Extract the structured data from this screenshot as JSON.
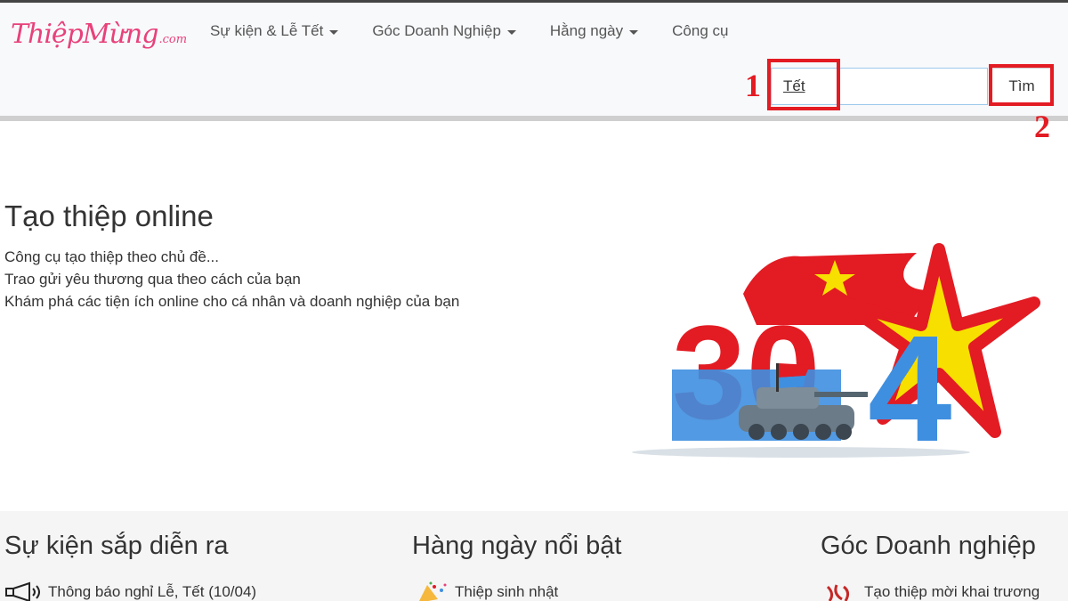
{
  "brand": {
    "logo_text": "ThiệpMừng",
    "logo_suffix": ".com"
  },
  "nav": {
    "items": [
      {
        "label": "Sự kiện & Lễ Tết",
        "dropdown": true
      },
      {
        "label": "Góc Doanh Nghiệp",
        "dropdown": true
      },
      {
        "label": "Hằng ngày",
        "dropdown": true
      },
      {
        "label": "Công cụ",
        "dropdown": false
      }
    ]
  },
  "search": {
    "value": "Tết",
    "button_label": "Tìm"
  },
  "annotations": {
    "step1": "1",
    "step2": "2",
    "color": "#e31b23"
  },
  "hero": {
    "title": "Tạo thiệp online",
    "lines": [
      "Công cụ tạo thiệp theo chủ đề...",
      "Trao gửi yêu thương qua theo cách của bạn",
      "Khám phá các tiện ích online cho cá nhân và doanh nghiệp của bạn"
    ]
  },
  "banner": {
    "text_left": "30",
    "text_right": "4"
  },
  "sections": [
    {
      "title": "Sự kiện sắp diễn ra",
      "first_item": "Thông báo nghỉ Lễ, Tết (10/04)",
      "icon": "megaphone-icon"
    },
    {
      "title": "Hàng ngày nổi bật",
      "first_item": "Thiệp sinh nhật",
      "icon": "party-popper-icon"
    },
    {
      "title": "Góc Doanh nghiệp",
      "first_item": "Tạo thiệp mời khai trương",
      "icon": "ribbon-icon"
    }
  ],
  "colors": {
    "brand_pink": "#e8417a",
    "flag_red": "#e31b23",
    "star_yellow": "#f7e000",
    "blue": "#3f8fe0"
  }
}
